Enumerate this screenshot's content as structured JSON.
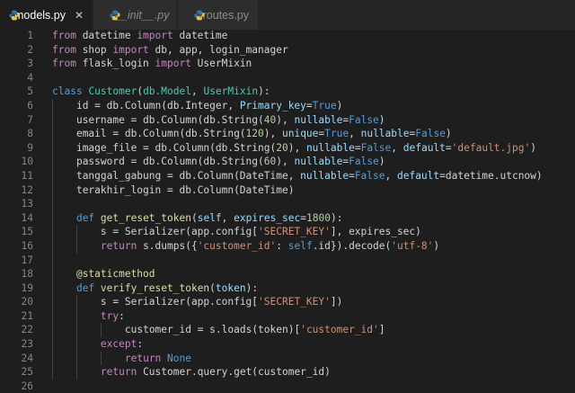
{
  "tabs": [
    {
      "label": "models.py",
      "active": true,
      "italic": false,
      "closable": true,
      "icon": "python-file-icon"
    },
    {
      "label": "__init__.py",
      "active": false,
      "italic": true,
      "closable": false,
      "icon": "python-file-icon"
    },
    {
      "label": "routes.py",
      "active": false,
      "italic": false,
      "closable": false,
      "icon": "python-file-icon"
    }
  ],
  "close_glyph": "✕",
  "colors": {
    "keyword": "#569cd6",
    "control": "#c586c0",
    "class": "#4ec9b0",
    "function": "#dcdcaa",
    "string": "#ce9178",
    "number": "#b5cea8",
    "parameter": "#9cdcfe",
    "text": "#d4d4d4",
    "line_number": "#858585",
    "background": "#1e1e1e"
  },
  "lines": [
    {
      "n": "1",
      "indent": 0,
      "tokens": [
        [
          "ctl",
          "from"
        ],
        [
          "op",
          " datetime "
        ],
        [
          "ctl",
          "import"
        ],
        [
          "op",
          " datetime"
        ]
      ]
    },
    {
      "n": "2",
      "indent": 0,
      "tokens": [
        [
          "ctl",
          "from"
        ],
        [
          "op",
          " shop "
        ],
        [
          "ctl",
          "import"
        ],
        [
          "op",
          " db, app, login_manager"
        ]
      ]
    },
    {
      "n": "3",
      "indent": 0,
      "tokens": [
        [
          "ctl",
          "from"
        ],
        [
          "op",
          " flask_login "
        ],
        [
          "ctl",
          "import"
        ],
        [
          "op",
          " UserMixin"
        ]
      ]
    },
    {
      "n": "4",
      "indent": 0,
      "tokens": []
    },
    {
      "n": "5",
      "indent": 0,
      "tokens": [
        [
          "kw",
          "class"
        ],
        [
          "op",
          " "
        ],
        [
          "cls",
          "Customer"
        ],
        [
          "op",
          "("
        ],
        [
          "cls",
          "db.Model"
        ],
        [
          "op",
          ", "
        ],
        [
          "cls",
          "UserMixin"
        ],
        [
          "op",
          "):"
        ]
      ]
    },
    {
      "n": "6",
      "indent": 1,
      "tokens": [
        [
          "op",
          "id = db.Column(db.Integer, "
        ],
        [
          "par",
          "Primary_key"
        ],
        [
          "op",
          "="
        ],
        [
          "kw",
          "True"
        ],
        [
          "op",
          ")"
        ]
      ]
    },
    {
      "n": "7",
      "indent": 1,
      "tokens": [
        [
          "op",
          "username = db.Column(db.String("
        ],
        [
          "num",
          "40"
        ],
        [
          "op",
          "), "
        ],
        [
          "par",
          "nullable"
        ],
        [
          "op",
          "="
        ],
        [
          "kw",
          "False"
        ],
        [
          "op",
          ")"
        ]
      ]
    },
    {
      "n": "8",
      "indent": 1,
      "tokens": [
        [
          "op",
          "email = db.Column(db.String("
        ],
        [
          "num",
          "120"
        ],
        [
          "op",
          "), "
        ],
        [
          "par",
          "unique"
        ],
        [
          "op",
          "="
        ],
        [
          "kw",
          "True"
        ],
        [
          "op",
          ", "
        ],
        [
          "par",
          "nullable"
        ],
        [
          "op",
          "="
        ],
        [
          "kw",
          "False"
        ],
        [
          "op",
          ")"
        ]
      ]
    },
    {
      "n": "9",
      "indent": 1,
      "tokens": [
        [
          "op",
          "image_file = db.Column(db.String("
        ],
        [
          "num",
          "20"
        ],
        [
          "op",
          "), "
        ],
        [
          "par",
          "nullable"
        ],
        [
          "op",
          "="
        ],
        [
          "kw",
          "False"
        ],
        [
          "op",
          ", "
        ],
        [
          "par",
          "default"
        ],
        [
          "op",
          "="
        ],
        [
          "str",
          "'default.jpg'"
        ],
        [
          "op",
          ")"
        ]
      ]
    },
    {
      "n": "10",
      "indent": 1,
      "tokens": [
        [
          "op",
          "password = db.Column(db.String("
        ],
        [
          "num",
          "60"
        ],
        [
          "op",
          "), "
        ],
        [
          "par",
          "nullable"
        ],
        [
          "op",
          "="
        ],
        [
          "kw",
          "False"
        ],
        [
          "op",
          ")"
        ]
      ]
    },
    {
      "n": "11",
      "indent": 1,
      "tokens": [
        [
          "op",
          "tanggal_gabung = db.Column(DateTime, "
        ],
        [
          "par",
          "nullable"
        ],
        [
          "op",
          "="
        ],
        [
          "kw",
          "False"
        ],
        [
          "op",
          ", "
        ],
        [
          "par",
          "default"
        ],
        [
          "op",
          "=datetime.utcnow)"
        ]
      ]
    },
    {
      "n": "12",
      "indent": 1,
      "tokens": [
        [
          "op",
          "terakhir_login = db.Column(DateTime)"
        ]
      ]
    },
    {
      "n": "13",
      "indent": 1,
      "tokens": []
    },
    {
      "n": "14",
      "indent": 1,
      "tokens": [
        [
          "kw",
          "def"
        ],
        [
          "op",
          " "
        ],
        [
          "fn",
          "get_reset_token"
        ],
        [
          "op",
          "("
        ],
        [
          "par",
          "self"
        ],
        [
          "op",
          ", "
        ],
        [
          "par",
          "expires_sec"
        ],
        [
          "op",
          "="
        ],
        [
          "num",
          "1800"
        ],
        [
          "op",
          "):"
        ]
      ]
    },
    {
      "n": "15",
      "indent": 2,
      "tokens": [
        [
          "op",
          "s = Serializer(app.config["
        ],
        [
          "str",
          "'SECRET_KEY'"
        ],
        [
          "op",
          "], expires_sec)"
        ]
      ]
    },
    {
      "n": "16",
      "indent": 2,
      "tokens": [
        [
          "ctl",
          "return"
        ],
        [
          "op",
          " s.dumps({"
        ],
        [
          "str",
          "'customer_id'"
        ],
        [
          "op",
          ": "
        ],
        [
          "kw",
          "self"
        ],
        [
          "op",
          ".id}).decode("
        ],
        [
          "str",
          "'utf-8'"
        ],
        [
          "op",
          ")"
        ]
      ]
    },
    {
      "n": "17",
      "indent": 1,
      "tokens": []
    },
    {
      "n": "18",
      "indent": 1,
      "tokens": [
        [
          "dec",
          "@staticmethod"
        ]
      ]
    },
    {
      "n": "19",
      "indent": 1,
      "tokens": [
        [
          "kw",
          "def"
        ],
        [
          "op",
          " "
        ],
        [
          "fn",
          "verify_reset_token"
        ],
        [
          "op",
          "("
        ],
        [
          "par",
          "token"
        ],
        [
          "op",
          "):"
        ]
      ]
    },
    {
      "n": "20",
      "indent": 2,
      "tokens": [
        [
          "op",
          "s = Serializer(app.config["
        ],
        [
          "str",
          "'SECRET_KEY'"
        ],
        [
          "op",
          "])"
        ]
      ]
    },
    {
      "n": "21",
      "indent": 2,
      "tokens": [
        [
          "ctl",
          "try"
        ],
        [
          "op",
          ":"
        ]
      ]
    },
    {
      "n": "22",
      "indent": 3,
      "tokens": [
        [
          "op",
          "customer_id = s.loads(token)["
        ],
        [
          "str",
          "'customer_id'"
        ],
        [
          "op",
          "]"
        ]
      ]
    },
    {
      "n": "23",
      "indent": 2,
      "tokens": [
        [
          "ctl",
          "except"
        ],
        [
          "op",
          ":"
        ]
      ]
    },
    {
      "n": "24",
      "indent": 3,
      "tokens": [
        [
          "ctl",
          "return"
        ],
        [
          "op",
          " "
        ],
        [
          "kw",
          "None"
        ]
      ]
    },
    {
      "n": "25",
      "indent": 2,
      "tokens": [
        [
          "ctl",
          "return"
        ],
        [
          "op",
          " Customer.query.get(customer_id)"
        ]
      ]
    },
    {
      "n": "26",
      "indent": 0,
      "tokens": []
    }
  ]
}
